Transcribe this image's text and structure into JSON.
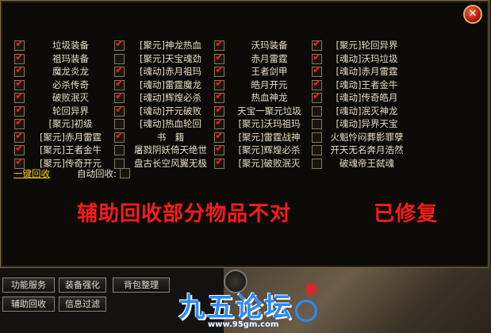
{
  "window": {
    "close_icon": "close-icon",
    "close_glyph": "✕"
  },
  "items": [
    [
      {
        "label": "垃圾装备",
        "checked": true
      },
      {
        "label": "[聚元]神龙热血",
        "checked": true
      },
      {
        "label": "沃玛装备",
        "checked": true
      },
      {
        "label": "[聚元]轮回异界",
        "checked": true
      }
    ],
    [
      {
        "label": "祖玛装备",
        "checked": true
      },
      {
        "label": "[聚元]天宝魂劲",
        "checked": false
      },
      {
        "label": "赤月雷霆",
        "checked": true
      },
      {
        "label": "[魂动]沃玛垃圾",
        "checked": true
      }
    ],
    [
      {
        "label": "魔龙炎龙",
        "checked": true
      },
      {
        "label": "[魂动]赤月祖玛",
        "checked": true
      },
      {
        "label": "王者剑甲",
        "checked": true
      },
      {
        "label": "[魂动]赤月雷霆",
        "checked": true
      }
    ],
    [
      {
        "label": "必杀传奇",
        "checked": true
      },
      {
        "label": "[魂动]雷霆魔龙",
        "checked": true
      },
      {
        "label": "皓月开元",
        "checked": true
      },
      {
        "label": "[魂动]王者金牛",
        "checked": true
      }
    ],
    [
      {
        "label": "破败泯灭",
        "checked": true
      },
      {
        "label": "[魂动]辉煌必杀",
        "checked": true
      },
      {
        "label": "热血神龙",
        "checked": true
      },
      {
        "label": "[魂动]传奇皓月",
        "checked": true
      }
    ],
    [
      {
        "label": "轮回异界",
        "checked": true
      },
      {
        "label": "[魂动]开元破败",
        "checked": true
      },
      {
        "label": "天宝一聚元垃圾",
        "checked": true
      },
      {
        "label": "[魂动]泯灭神龙",
        "checked": false
      }
    ],
    [
      {
        "label": "[聚元]初级",
        "checked": true
      },
      {
        "label": "[魂动]热血轮回",
        "checked": false
      },
      {
        "label": "[聚元]沃玛祖玛",
        "checked": true
      },
      {
        "label": "[魂动]异界天宝",
        "checked": false
      }
    ],
    [
      {
        "label": "[聚元]赤月雷霆",
        "checked": true
      },
      {
        "label": "书　籍",
        "checked": true
      },
      {
        "label": "[聚元]雷霆战神",
        "checked": true
      },
      {
        "label": "火魁怜闷葬影罪孽",
        "checked": false
      }
    ],
    [
      {
        "label": "[聚元]王者金牛",
        "checked": true
      },
      {
        "label": "屠戮阴妖倚天绝世",
        "checked": false
      },
      {
        "label": "[聚元]辉煌必杀",
        "checked": true
      },
      {
        "label": "开天无名奔月浩然",
        "checked": false
      }
    ],
    [
      {
        "label": "[聚元]传奇开元",
        "checked": true
      },
      {
        "label": "盘古长空风翼无极",
        "checked": false
      },
      {
        "label": "[聚元]破败泯灭",
        "checked": true
      },
      {
        "label": "破魂帝王弑魂",
        "checked": false
      }
    ]
  ],
  "footer": {
    "recycle_link": "一键回收",
    "auto_label": "自动回收:",
    "auto_checked": false
  },
  "notice": {
    "main": "辅助回收部分物品不对",
    "status": "已修复"
  },
  "bottom_buttons": [
    {
      "label": "功能服务"
    },
    {
      "label": "装备强化"
    },
    {
      "label": "背包整理"
    },
    {
      "label": "辅助回收"
    },
    {
      "label": "信息过滤"
    }
  ],
  "logo": {
    "text": "九五论坛",
    "url": "www.95gm.com",
    "badge": "新"
  }
}
